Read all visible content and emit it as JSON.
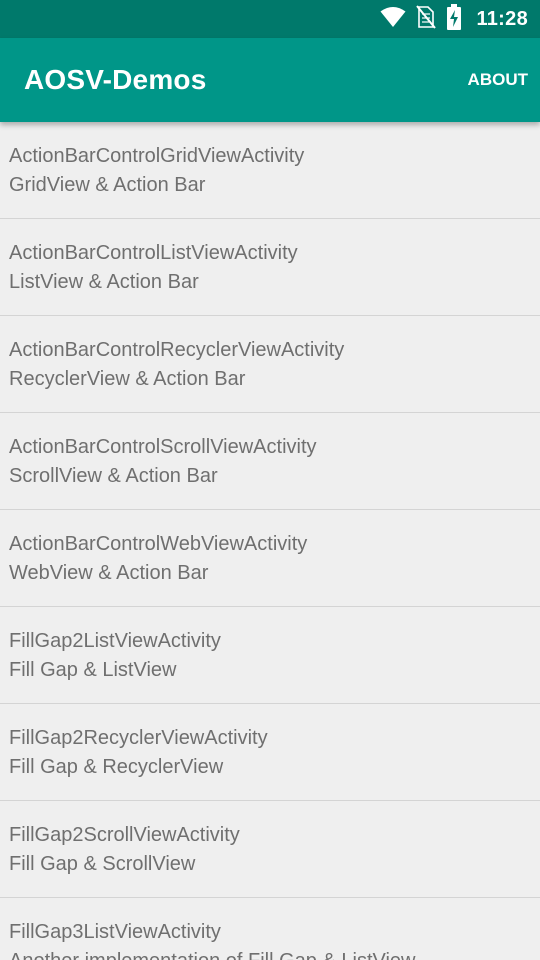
{
  "status_bar": {
    "time": "11:28",
    "icons": [
      "wifi-icon",
      "no-sim-icon",
      "battery-charging-icon"
    ]
  },
  "app_bar": {
    "title": "AOSV-Demos",
    "about_label": "ABOUT"
  },
  "colors": {
    "status_bar": "#00796b",
    "app_bar": "#009688",
    "background": "#efefef",
    "text": "#6f6f6f",
    "divider": "#d4d4d4"
  },
  "list": {
    "items": [
      {
        "title": "ActionBarControlGridViewActivity",
        "subtitle": "GridView & Action Bar"
      },
      {
        "title": "ActionBarControlListViewActivity",
        "subtitle": "ListView & Action Bar"
      },
      {
        "title": "ActionBarControlRecyclerViewActivity",
        "subtitle": "RecyclerView & Action Bar"
      },
      {
        "title": "ActionBarControlScrollViewActivity",
        "subtitle": "ScrollView & Action Bar"
      },
      {
        "title": "ActionBarControlWebViewActivity",
        "subtitle": "WebView & Action Bar"
      },
      {
        "title": "FillGap2ListViewActivity",
        "subtitle": "Fill Gap & ListView"
      },
      {
        "title": "FillGap2RecyclerViewActivity",
        "subtitle": "Fill Gap & RecyclerView"
      },
      {
        "title": "FillGap2ScrollViewActivity",
        "subtitle": "Fill Gap & ScrollView"
      },
      {
        "title": "FillGap3ListViewActivity",
        "subtitle": "Another implementation of Fill Gap & ListView"
      }
    ]
  }
}
